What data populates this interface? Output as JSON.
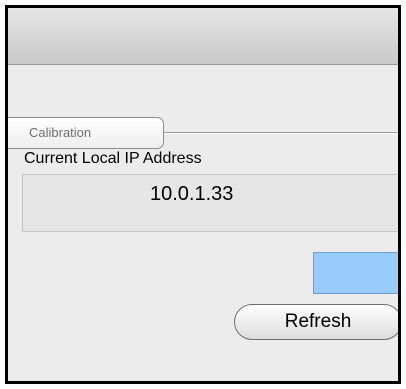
{
  "tabs": {
    "calibration_label": "Calibration"
  },
  "network": {
    "heading": "Current Local IP Address",
    "ip_value": "10.0.1.33",
    "refresh_label": "Refresh"
  }
}
